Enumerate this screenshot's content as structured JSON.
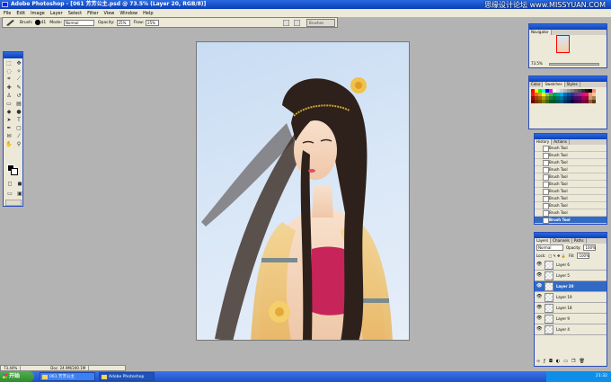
{
  "window": {
    "title": "Adobe Photoshop - [061 芳芳公主.psd @ 73.5% (Layer 20, RGB/8)]"
  },
  "watermark": "思缘设计论坛  www.MISSYUAN.COM",
  "menu": [
    "File",
    "Edit",
    "Image",
    "Layer",
    "Select",
    "Filter",
    "View",
    "Window",
    "Help"
  ],
  "options": {
    "brush_label": "Brush:",
    "brush_size": "41",
    "mode_label": "Mode:",
    "mode_value": "Normal",
    "opacity_label": "Opacity:",
    "opacity_value": "25%",
    "flow_label": "Flow:",
    "flow_value": "25%",
    "brushes_tab": "Brushes"
  },
  "navigator": {
    "tab": "Navigator",
    "zoom": "73.5%"
  },
  "swatches": {
    "tabs": [
      "Color",
      "Swatches",
      "Styles"
    ],
    "colors": [
      "#ff0000",
      "#ffff00",
      "#00ff00",
      "#00ffff",
      "#0000ff",
      "#ff00ff",
      "#ffffff",
      "#e6e6e6",
      "#cccccc",
      "#b3b3b3",
      "#999999",
      "#808080",
      "#666666",
      "#4d4d4d",
      "#333333",
      "#1a1a1a",
      "#000000",
      "#ff8080",
      "#ed1c24",
      "#f26522",
      "#f7941d",
      "#fff200",
      "#8dc63f",
      "#39b54a",
      "#00a651",
      "#00a99d",
      "#00aeef",
      "#0072bc",
      "#0054a6",
      "#2e3192",
      "#662d91",
      "#92278f",
      "#ec008c",
      "#ed145b",
      "#f69679",
      "#fdc689",
      "#9e0b0f",
      "#a0410d",
      "#a36209",
      "#aba000",
      "#598527",
      "#197b30",
      "#007236",
      "#00746b",
      "#0076a3",
      "#004a80",
      "#003471",
      "#1b1464",
      "#440e62",
      "#630460",
      "#9e005d",
      "#9e0039",
      "#c69c6d",
      "#a67c52",
      "#790000",
      "#7b2e00",
      "#7d4900",
      "#827b00",
      "#406618",
      "#005e20",
      "#005826",
      "#005952",
      "#005b7f",
      "#003663",
      "#002157",
      "#0d004c",
      "#32004b",
      "#4b0049",
      "#7b0046",
      "#7a0026",
      "#8c6239",
      "#603913"
    ]
  },
  "history": {
    "tabs": [
      "History",
      "Actions"
    ],
    "items": [
      "Brush Tool",
      "Brush Tool",
      "Brush Tool",
      "Brush Tool",
      "Brush Tool",
      "Brush Tool",
      "Brush Tool",
      "Brush Tool",
      "Brush Tool",
      "Brush Tool",
      "Brush Tool"
    ],
    "active_index": 10
  },
  "layers": {
    "tabs": [
      "Layers",
      "Channels",
      "Paths"
    ],
    "blend_mode": "Normal",
    "opacity_label": "Opacity:",
    "opacity_value": "100%",
    "lock_label": "Lock:",
    "fill_label": "Fill:",
    "fill_value": "100%",
    "items": [
      "Layer 6",
      "Layer 5",
      "Layer 20",
      "Layer 19",
      "Layer 18",
      "Layer 9",
      "Layer 4"
    ],
    "active_index": 2
  },
  "status": {
    "zoom": "73.44%",
    "doc": "Doc: 24.9M/240.1M"
  },
  "taskbar": {
    "start": "开始",
    "tasks": [
      "061 芳芳公主",
      "Adobe Photoshop"
    ],
    "clock": "21:32"
  }
}
